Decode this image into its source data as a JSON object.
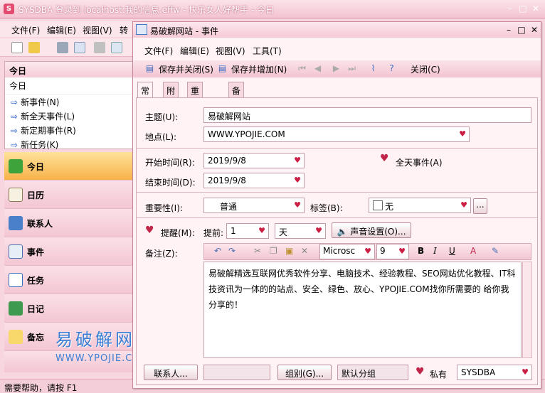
{
  "window": {
    "title": "SYSDBA 登录到 localhost:我的信息.effw - 快乐女人好帮手 - 今日",
    "app_icon_label": "S"
  },
  "main": {
    "menu": [
      "文件(F)",
      "编辑(E)",
      "视图(V)",
      "转"
    ],
    "today": {
      "header": "今日",
      "subheader": "今日",
      "links": [
        "新事件(N)",
        "新全天事件(L)",
        "新定期事件(R)",
        "新任务(K)"
      ]
    },
    "nav": [
      "今日",
      "日历",
      "联系人",
      "事件",
      "任务",
      "日记",
      "备忘"
    ],
    "status": "需要帮助，请按 F1"
  },
  "dialog": {
    "title": "易破解网站 - 事件",
    "menu": [
      "文件(F)",
      "编辑(E)",
      "视图(V)",
      "工具(T)"
    ],
    "toolbar": {
      "save_close": "保存并关闭(S)",
      "save_new": "保存并增加(N)",
      "close": "关闭(C)"
    },
    "tabs": [
      "常规",
      "附件",
      "重复周期",
      "备注"
    ],
    "form": {
      "subject_label": "主题(U):",
      "subject_value": "易破解网站",
      "location_label": "地点(L):",
      "location_value": "WWW.YPOJIE.COM",
      "start_label": "开始时间(R):",
      "start_value": "2019/9/8",
      "end_label": "结束时间(D):",
      "end_value": "2019/9/8",
      "allday_label": "全天事件(A)",
      "importance_label": "重要性(I):",
      "importance_value": "普通",
      "tag_label": "标签(B):",
      "tag_value": "无",
      "tag_more": "...",
      "reminder_label": "提醒(M):",
      "before_label": "提前:",
      "before_value": "1",
      "before_unit": "天",
      "sound_button": "声音设置(O)...",
      "notes_label": "备注(Z):",
      "font_name": "Microsc",
      "font_size": "9",
      "notes_text": "易破解精选互联网优秀软件分享、电脑技术、经验教程、SEO网站优化教程、IT科技资讯为一体的的站点、安全、绿色、放心、YPOJIE.COM找你所需要的 给你我分享的！",
      "contacts_button": "联系人...",
      "group_button": "组别(G)...",
      "group_value": "默认分组",
      "private_label": "私有",
      "owner_value": "SYSDBA"
    }
  },
  "watermark": {
    "line1": "易破解网站",
    "line2": "WWW.YPOJIE.COM"
  },
  "colors": {
    "accent": "#cc1f45",
    "nav_active": "#f7b24a",
    "panel": "#f3c6d3"
  }
}
